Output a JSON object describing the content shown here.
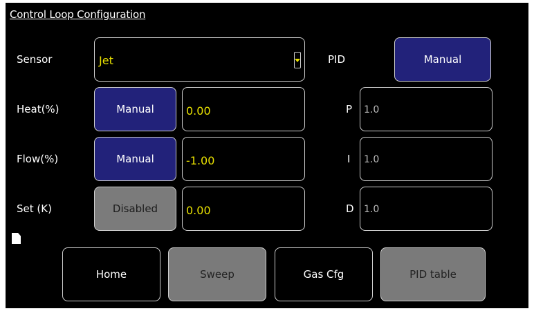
{
  "title": "Control Loop Configuration",
  "rows": {
    "sensor": {
      "label": "Sensor",
      "value": "Jet"
    },
    "heat": {
      "label": "Heat(%)",
      "mode": "Manual",
      "value": "0.00"
    },
    "flow": {
      "label": "Flow(%)",
      "mode": "Manual",
      "value": "-1.00"
    },
    "set": {
      "label": "Set (K)",
      "mode": "Disabled",
      "value": "0.00"
    }
  },
  "pid": {
    "label": "PID",
    "mode": "Manual",
    "p": {
      "label": "P",
      "value": "1.0"
    },
    "i": {
      "label": "I",
      "value": "1.0"
    },
    "d": {
      "label": "D",
      "value": "1.0"
    }
  },
  "nav": {
    "home": "Home",
    "sweep": "Sweep",
    "gas_cfg": "Gas Cfg",
    "pid_table": "PID table"
  },
  "colors": {
    "manual_button": "#22227a",
    "disabled_button": "#7b7b7b",
    "value_text": "#e8e000"
  },
  "icons": [
    "document-icon",
    "dropdown-arrow-icon"
  ]
}
